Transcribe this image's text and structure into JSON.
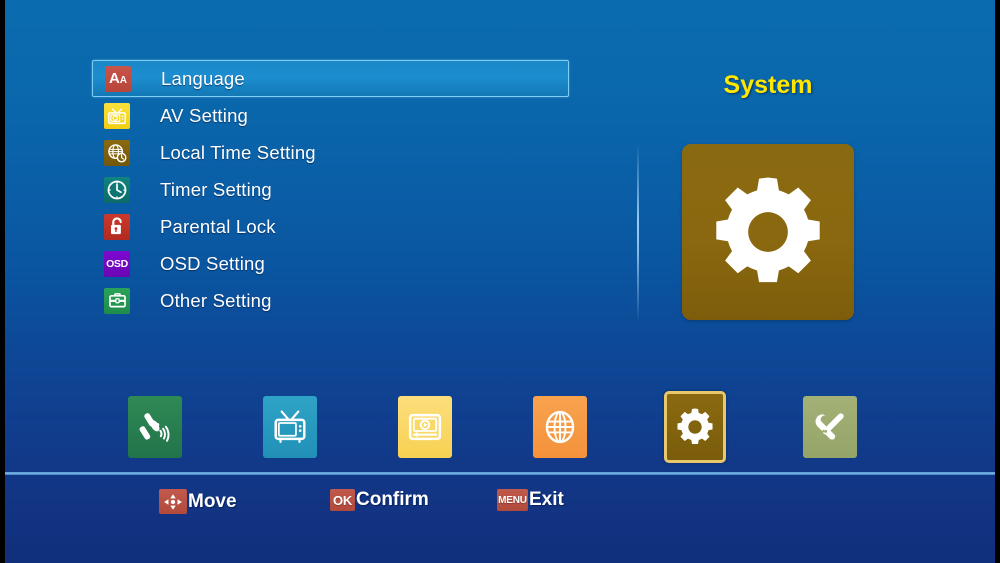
{
  "screen": {
    "title": "System",
    "title_color": "#ffe800",
    "background_top_color": "#0a6cae",
    "background_bottom_color": "#102f7c"
  },
  "menu": {
    "selected_index": 0,
    "items": [
      {
        "label": "Language",
        "icon": "language-aa-icon",
        "icon_color": "#c0493e",
        "selected": true
      },
      {
        "label": "AV Setting",
        "icon": "av-television-icon",
        "icon_color": "#f7d714",
        "selected": false
      },
      {
        "label": "Local Time Setting",
        "icon": "globe-clock-icon",
        "icon_color": "#7f600d",
        "selected": false
      },
      {
        "label": "Timer Setting",
        "icon": "clock-icon",
        "icon_color": "#0e7a76",
        "selected": false
      },
      {
        "label": "Parental Lock",
        "icon": "padlock-open-icon",
        "icon_color": "#c13226",
        "selected": false
      },
      {
        "label": "OSD Setting",
        "icon": "osd-text-icon",
        "icon_color": "#7309c2",
        "selected": false
      },
      {
        "label": "Other Setting",
        "icon": "briefcase-icon",
        "icon_color": "#249a52",
        "selected": false
      }
    ]
  },
  "panel": {
    "title": "System",
    "icon": "gear-icon",
    "icon_background": "#8a6a10",
    "icon_color": "#ffffff"
  },
  "icon_bar": {
    "selected_index": 4,
    "items": [
      {
        "name": "installation",
        "icon": "satellite-dish-icon",
        "color": "#2a7e4e"
      },
      {
        "name": "channel",
        "icon": "television-icon",
        "color": "#2a9ac0"
      },
      {
        "name": "media",
        "icon": "media-player-icon",
        "color": "#fad96b"
      },
      {
        "name": "network",
        "icon": "globe-icon",
        "color": "#f69a46"
      },
      {
        "name": "system",
        "icon": "gear-icon",
        "color": "#83650f"
      },
      {
        "name": "tools",
        "icon": "wrench-screwdriver-icon",
        "color": "#9dac71"
      }
    ]
  },
  "help_bar": {
    "items": [
      {
        "key": "",
        "key_icon": "dpad-arrows-icon",
        "label": "Move"
      },
      {
        "key": "OK",
        "key_icon": "",
        "label": "Confirm"
      },
      {
        "key": "MENU",
        "key_icon": "",
        "label": "Exit"
      }
    ],
    "key_badge_color": "#b9503f"
  }
}
